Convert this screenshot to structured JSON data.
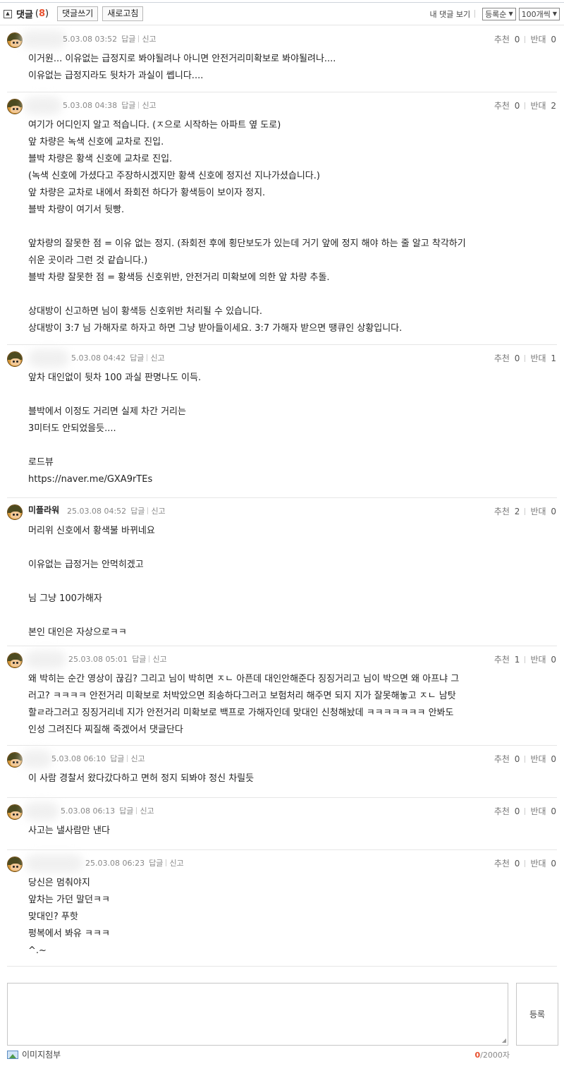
{
  "header": {
    "collapse_icon": "collapse-icon",
    "title": "댓글",
    "count": "8",
    "write_label": "댓글쓰기",
    "refresh_label": "새로고침",
    "my_comments_label": "내 댓글 보기",
    "sort_value": "등록순",
    "per_page_value": "100개씩"
  },
  "comments": [
    {
      "name": "",
      "date": "5.03.08 03:52",
      "reply": "답글",
      "report": "신고",
      "up_label": "추천",
      "up": "0",
      "down_label": "반대",
      "down": "0",
      "lines": [
        "이거원... 이유없는 급정지로 봐야될려나 아니면 안전거리미확보로 봐야될려나....",
        "이유없는 급정지라도 뒷차가 과실이 쎕니다...."
      ]
    },
    {
      "name": "",
      "date": "5.03.08 04:38",
      "reply": "답글",
      "report": "신고",
      "up_label": "추천",
      "up": "0",
      "down_label": "반대",
      "down": "2",
      "lines": [
        "여기가 어디인지 알고 적습니다. (ㅈ으로 시작하는 아파트 옆 도로)",
        "앞 차량은 녹색 신호에 교차로 진입.",
        "블박 차량은 황색 신호에 교차로 진입.",
        "(녹색 신호에 가셨다고 주장하시겠지만 황색 신호에 정지선 지나가셨습니다.)",
        "앞 차량은 교차로 내에서 좌회전 하다가 황색등이 보이자 정지.",
        "블박 차량이 여기서 뒷빵.",
        "",
        "앞차량의 잘못한 점 = 이유 없는 정지. (좌회전 후에 횡단보도가 있는데 거기 앞에 정지 해야 하는 줄 알고 착각하기",
        "쉬운 곳이라 그런 것 같습니다.)",
        "블박 차량 잘못한 점 = 황색등 신호위반, 안전거리 미확보에 의한 앞 차량 추돌.",
        "",
        "상대방이 신고하면 님이 황색등 신호위반 처리될 수 있습니다.",
        "상대방이 3:7 님 가해자로 하자고 하면 그냥 받아들이세요. 3:7 가해자 받으면 땡큐인 상황입니다."
      ]
    },
    {
      "name": "",
      "date": "5.03.08 04:42",
      "reply": "답글",
      "report": "신고",
      "up_label": "추천",
      "up": "0",
      "down_label": "반대",
      "down": "1",
      "lines": [
        "앞차 대인없이 뒷차 100 과실 판명나도 이득.",
        "",
        "블박에서 이정도 거리면 실제 차간 거리는",
        "3미터도 안되었을듯....",
        "",
        "로드뷰",
        "https://naver.me/GXA9rTEs"
      ]
    },
    {
      "name": "미플라워",
      "date": "25.03.08 04:52",
      "reply": "답글",
      "report": "신고",
      "up_label": "추천",
      "up": "2",
      "down_label": "반대",
      "down": "0",
      "lines": [
        "머리위 신호에서 황색불 바뀌네요",
        "",
        "이유없는 급정거는 안먹히겠고",
        "",
        "님 그냥 100가해자",
        "",
        "본인 대인은 자상으로ㅋㅋ"
      ]
    },
    {
      "name": "",
      "date": "25.03.08 05:01",
      "reply": "답글",
      "report": "신고",
      "up_label": "추천",
      "up": "1",
      "down_label": "반대",
      "down": "0",
      "lines": [
        "왜 박히는 순간 영상이 끊김? 그리고 님이 박히면 ㅈㄴ 아픈데 대인안해준다 징징거리고 님이 박으면 왜 아프냐 그",
        "러고? ㅋㅋㅋㅋ 안전거리 미확보로 처박았으면 죄송하다그러고 보험처리 해주면 되지 지가 잘못해놓고 ㅈㄴ 남탓",
        "할ㄹ라그러고 징징거리네 지가 안전거리 미확보로 백프로 가해자인데 맞대인 신청해놨데 ㅋㅋㅋㅋㅋㅋㅋ 안봐도",
        "인성 그려진다 찌질해 죽겠어서 댓글단다"
      ]
    },
    {
      "name": "",
      "date": "5.03.08 06:10",
      "reply": "답글",
      "report": "신고",
      "up_label": "추천",
      "up": "0",
      "down_label": "반대",
      "down": "0",
      "lines": [
        "이 사람 경찰서 왔다갔다하고 면허 정지 되봐야 정신 차릴듯"
      ]
    },
    {
      "name": "",
      "date": "5.03.08 06:13",
      "reply": "답글",
      "report": "신고",
      "up_label": "추천",
      "up": "0",
      "down_label": "반대",
      "down": "0",
      "lines": [
        "사고는 낼사람만 낸다"
      ]
    },
    {
      "name": "",
      "date": "25.03.08 06:23",
      "reply": "답글",
      "report": "신고",
      "up_label": "추천",
      "up": "0",
      "down_label": "반대",
      "down": "0",
      "lines": [
        "당신은 멈춰야지",
        "앞차는 가던 말던ㅋㅋ",
        "맞대인? 푸핫",
        "펑복에서 봐유 ㅋㅋㅋ",
        "^.~"
      ]
    }
  ],
  "editor": {
    "submit_label": "등록",
    "attach_label": "이미지첨부",
    "count_current": "0",
    "count_max": "/2000자"
  }
}
